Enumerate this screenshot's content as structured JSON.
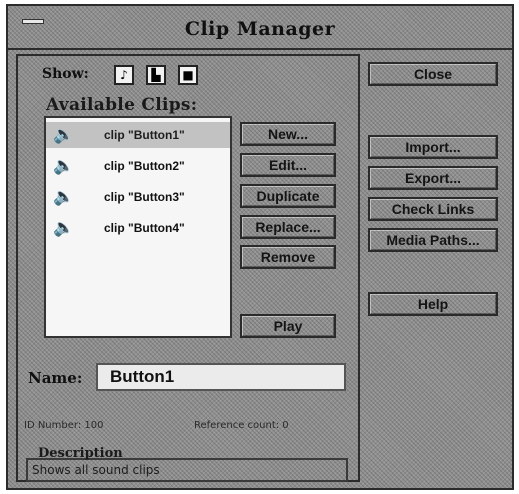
{
  "window": {
    "title": "Clip Manager"
  },
  "filter": {
    "label": "Show:",
    "buttons": [
      {
        "name": "sound",
        "glyph": "♪"
      },
      {
        "name": "picture",
        "glyph": "▙"
      },
      {
        "name": "video",
        "glyph": "■"
      }
    ]
  },
  "clips": {
    "label": "Available Clips:",
    "items": [
      {
        "label": "clip \"Button1\"",
        "icon": "speaker-icon",
        "glyph": "🔈",
        "selected": true
      },
      {
        "label": "clip \"Button2\"",
        "icon": "speaker-icon",
        "glyph": "🔈",
        "selected": false
      },
      {
        "label": "clip \"Button3\"",
        "icon": "speaker-icon",
        "glyph": "🔈",
        "selected": false
      },
      {
        "label": "clip \"Button4\"",
        "icon": "speaker-icon",
        "glyph": "🔈",
        "selected": false
      }
    ]
  },
  "actions": {
    "new": "New...",
    "edit": "Edit...",
    "duplicate": "Duplicate",
    "replace": "Replace...",
    "remove": "Remove",
    "play": "Play"
  },
  "side": {
    "close": "Close",
    "import": "Import...",
    "export": "Export...",
    "check_links": "Check Links",
    "media_paths": "Media Paths...",
    "help": "Help"
  },
  "name": {
    "label": "Name:",
    "value": "Button1"
  },
  "info": {
    "id_number": "ID Number: 100",
    "reference_count": "Reference count: 0"
  },
  "description": {
    "label": "Description",
    "text": "Shows all sound clips"
  }
}
